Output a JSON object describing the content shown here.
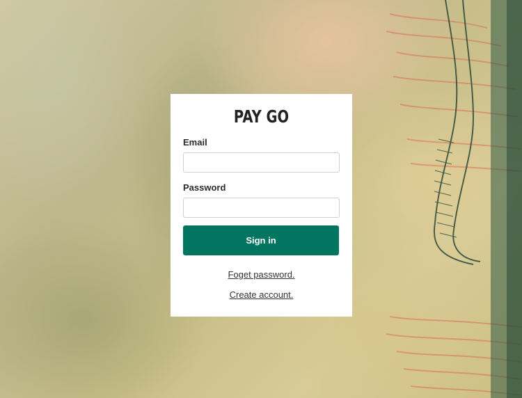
{
  "app": {
    "title": "PAY GO"
  },
  "form": {
    "email_label": "Email",
    "email_value": "",
    "email_placeholder": "",
    "password_label": "Password",
    "password_value": "",
    "password_placeholder": "",
    "signin_label": "Sign in"
  },
  "links": {
    "forgot_password": "Foget password.",
    "create_account": "Create account."
  },
  "colors": {
    "primary_button": "#027560",
    "card_background": "#ffffff"
  }
}
